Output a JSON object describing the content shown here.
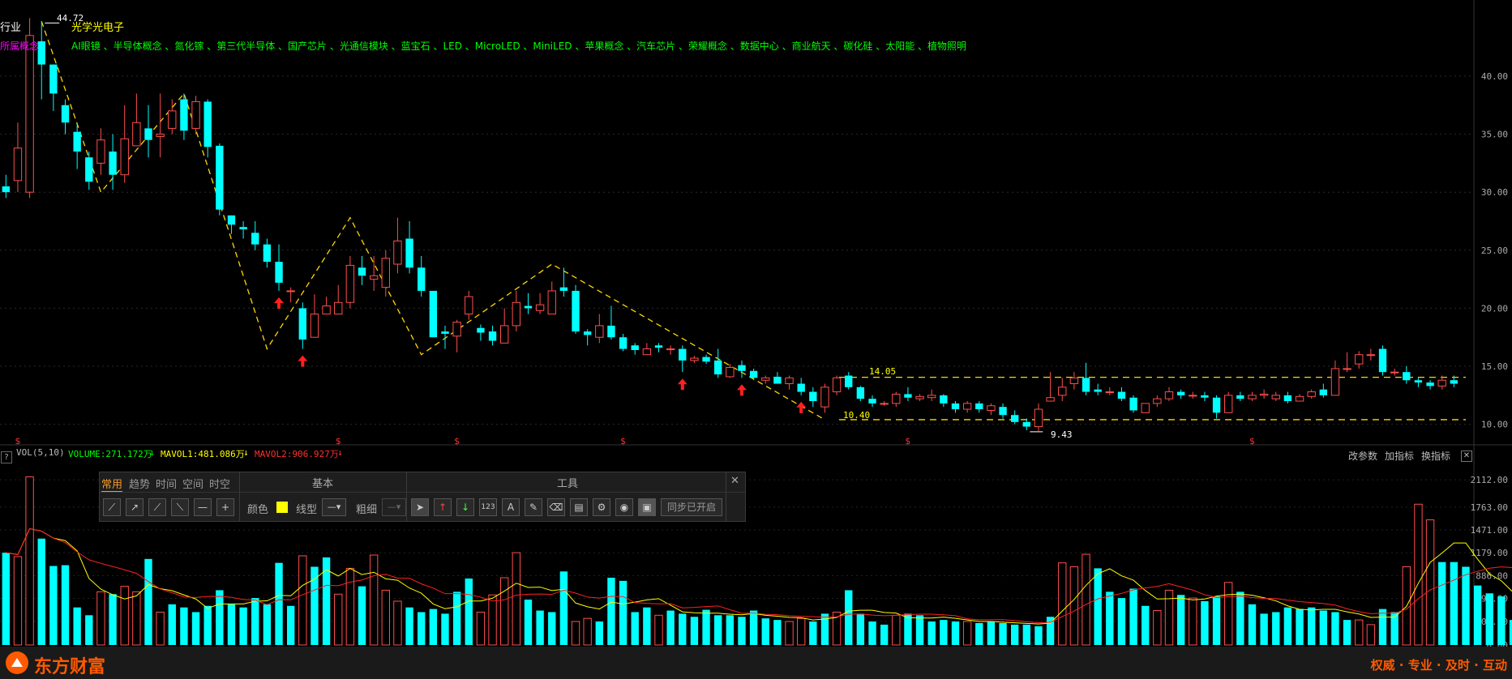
{
  "header": {
    "industry_label": "行业",
    "concept_label": "所属概念",
    "stock_name": "光学光电子",
    "concepts": "AI眼镜 、半导体概念 、氮化镓 、第三代半导体 、国产芯片 、光通信模块 、蓝宝石 、LED 、MicroLED 、MiniLED 、苹果概念 、汽车芯片 、荣耀概念 、数据中心 、商业航天 、碳化硅 、太阳能 、植物照明"
  },
  "price_annotations": {
    "high_label": "44.72",
    "level_upper": "14.05",
    "level_lower": "10.40",
    "low_label": "9.43"
  },
  "volume_panel": {
    "help": "?",
    "title": "VOL(5,10)",
    "volume": "VOLUME:271.172万",
    "mavol1": "MAVOL1:481.086万",
    "mavol2": "MAVOL2:906.927万",
    "change_params": "改参数",
    "add_indicator": "加指标",
    "switch_indicator": "换指标",
    "close": "✕"
  },
  "toolbar": {
    "tabs": [
      "常用",
      "趋势",
      "时间",
      "空间",
      "时空"
    ],
    "basic_title": "基本",
    "tools_title": "工具",
    "color_label": "颜色",
    "line_type_label": "线型",
    "thickness_label": "粗细",
    "sync_label": "同步已开启",
    "close": "✕",
    "tool_123": "123",
    "tool_a": "A"
  },
  "footer": {
    "brand": "东方财富",
    "slogan": "权威 · 专业 · 及时 · 互动"
  },
  "colors": {
    "up": "#ff4d4d",
    "down": "#00ffff",
    "ma1": "#ffff00",
    "ma2": "#ff2020",
    "zigzag": "#ffd700",
    "axis_text": "#aaaaaa",
    "brand": "#ff5a00",
    "concept_text": "#00ff00",
    "name_text": "#ffff00",
    "concept_label": "#ff00ff"
  },
  "chart_data": [
    {
      "type": "candlestick",
      "ylim": [
        9,
        46
      ],
      "yticks": [
        "40.00",
        "35.00",
        "30.00",
        "25.00",
        "20.00",
        "15.00",
        "10.00"
      ],
      "ytick_values": [
        40,
        35,
        30,
        25,
        20,
        15,
        10
      ],
      "candles": [
        [
          30.5,
          30,
          31.5,
          29.5
        ],
        [
          31,
          33.8,
          36,
          30
        ],
        [
          30,
          43.5,
          45,
          29.5
        ],
        [
          43,
          41,
          44.72,
          38
        ],
        [
          41,
          38.5,
          41,
          37
        ],
        [
          37.5,
          36,
          38,
          35
        ],
        [
          35.2,
          33.5,
          36,
          32
        ],
        [
          33,
          30.9,
          33.5,
          30.2
        ],
        [
          32.5,
          34.5,
          35.5,
          31.5
        ],
        [
          33.5,
          31.5,
          35,
          30.2
        ],
        [
          31.5,
          34.6,
          37.5,
          30.8
        ],
        [
          34,
          36,
          38.5,
          34
        ],
        [
          35.5,
          34.5,
          37.5,
          33
        ],
        [
          34.8,
          35,
          38.5,
          33
        ],
        [
          35.5,
          37,
          38,
          35
        ],
        [
          38,
          35.3,
          38.5,
          34.5
        ],
        [
          35.5,
          37.8,
          38.3,
          35
        ],
        [
          37.8,
          33.9,
          38,
          33
        ],
        [
          34,
          28.5,
          34.2,
          28
        ],
        [
          28,
          27.2,
          28,
          26.4
        ],
        [
          27,
          26.8,
          27.5,
          26
        ],
        [
          26.5,
          25.5,
          27.5,
          25
        ],
        [
          25.5,
          24,
          26,
          23.5
        ],
        [
          24,
          22.2,
          25.5,
          21.5
        ],
        [
          21.5,
          21.5,
          21.8,
          20.5
        ],
        [
          20,
          17.3,
          20.5,
          16.5
        ],
        [
          17.5,
          19.5,
          21.2,
          17.5
        ],
        [
          19.5,
          20.2,
          21,
          19.5
        ],
        [
          19.5,
          20.5,
          22,
          19.5
        ],
        [
          20.5,
          23.7,
          24.5,
          20
        ],
        [
          23.5,
          22.8,
          24.5,
          22
        ],
        [
          22.5,
          22.8,
          24.5,
          21.5
        ],
        [
          21.8,
          24.3,
          25,
          21
        ],
        [
          23.8,
          25.8,
          27.8,
          23
        ],
        [
          26,
          23.5,
          27.5,
          23
        ],
        [
          23.5,
          21.5,
          24.5,
          21
        ],
        [
          21.5,
          17.5,
          21.5,
          17.5
        ],
        [
          18,
          17.8,
          18.5,
          16.5
        ],
        [
          17.6,
          18.8,
          19,
          16.2
        ],
        [
          19.5,
          21,
          21.5,
          19
        ],
        [
          18.3,
          17.9,
          18.6,
          17.2
        ],
        [
          18,
          17.2,
          18.5,
          16.8
        ],
        [
          17,
          18.5,
          20,
          17
        ],
        [
          18.5,
          20.5,
          21.5,
          18
        ],
        [
          20.2,
          20,
          21.3,
          19.5
        ],
        [
          19.8,
          20.3,
          21.3,
          19.5
        ],
        [
          19.5,
          21.5,
          22.3,
          19.5
        ],
        [
          21.8,
          21.5,
          23.5,
          21
        ],
        [
          21.5,
          18,
          22,
          17.8
        ],
        [
          18,
          17.7,
          18.2,
          16.8
        ],
        [
          17.5,
          18.5,
          19.5,
          17
        ],
        [
          18.5,
          17.5,
          20.2,
          17.3
        ],
        [
          17.5,
          16.5,
          17.8,
          16.3
        ],
        [
          16.8,
          16.4,
          17,
          16
        ],
        [
          16,
          16.5,
          17,
          16
        ],
        [
          16.8,
          16.6,
          17,
          16.2
        ],
        [
          16.5,
          16.5,
          16.8,
          16
        ],
        [
          16.5,
          15.5,
          16.8,
          14.5
        ],
        [
          15.5,
          15.7,
          15.9,
          15.3
        ],
        [
          15.8,
          15.4,
          16,
          15.2
        ],
        [
          15.5,
          14.3,
          16.5,
          14
        ],
        [
          14.1,
          14.9,
          15.2,
          14
        ],
        [
          15.1,
          14.6,
          15.5,
          14
        ],
        [
          14.6,
          14,
          14.8,
          13.8
        ],
        [
          13.8,
          14,
          14.2,
          13.5
        ],
        [
          14.1,
          13.5,
          14.5,
          13.5
        ],
        [
          13.5,
          14,
          14.2,
          13
        ],
        [
          13.5,
          12.8,
          14,
          12.5
        ],
        [
          12.8,
          12,
          13.2,
          11.5
        ],
        [
          11.5,
          13.2,
          13.5,
          11
        ],
        [
          12.8,
          14,
          14.2,
          12.5
        ],
        [
          14.2,
          13.2,
          14.5,
          13
        ],
        [
          13.2,
          12.2,
          13.3,
          12
        ],
        [
          12.2,
          11.8,
          12.5,
          11.5
        ],
        [
          11.8,
          11.8,
          12,
          11.6
        ],
        [
          11.8,
          12.6,
          12.8,
          11.5
        ],
        [
          12.6,
          12.3,
          13.2,
          12
        ],
        [
          12.2,
          12.4,
          12.6,
          12
        ],
        [
          12.3,
          12.5,
          13,
          12
        ],
        [
          12.5,
          11.8,
          12.6,
          11.5
        ],
        [
          11.8,
          11.3,
          12,
          11
        ],
        [
          11.3,
          11.8,
          12,
          11
        ],
        [
          11.8,
          11.3,
          12,
          11
        ],
        [
          11.2,
          11.6,
          11.8,
          10.8
        ],
        [
          11.5,
          10.8,
          11.8,
          10.5
        ],
        [
          10.8,
          10.2,
          11.2,
          10
        ],
        [
          10.2,
          9.8,
          10.5,
          9.5
        ],
        [
          9.8,
          11.3,
          11.8,
          9.43
        ],
        [
          12,
          12.3,
          14.5,
          12
        ],
        [
          12.5,
          13.2,
          14,
          12
        ],
        [
          13.5,
          14,
          14.5,
          13
        ],
        [
          14,
          12.8,
          15.3,
          12.5
        ],
        [
          13,
          12.8,
          13.5,
          12.5
        ],
        [
          12.8,
          12.8,
          13.2,
          12.5
        ],
        [
          12.8,
          12.2,
          13.2,
          12
        ],
        [
          12.3,
          11.2,
          12.5,
          11
        ],
        [
          11,
          11.8,
          11.8,
          11
        ],
        [
          11.8,
          12.2,
          12.5,
          11.5
        ],
        [
          12.2,
          12.8,
          13.2,
          12
        ],
        [
          12.8,
          12.5,
          13,
          12.2
        ],
        [
          12.5,
          12.5,
          12.8,
          12.2
        ],
        [
          12.5,
          12.3,
          12.8,
          12
        ],
        [
          12.3,
          11,
          12.5,
          10.5
        ],
        [
          11,
          12.5,
          12.8,
          11
        ],
        [
          12.5,
          12.2,
          12.8,
          12
        ],
        [
          12.2,
          12.5,
          12.8,
          12
        ],
        [
          12.5,
          12.6,
          13,
          12.2
        ],
        [
          12.2,
          12.5,
          12.8,
          12
        ],
        [
          12.5,
          12,
          12.8,
          11.8
        ],
        [
          12,
          12.4,
          12.6,
          12
        ],
        [
          12.4,
          12.8,
          13,
          12.2
        ],
        [
          13,
          12.5,
          13.5,
          12.3
        ],
        [
          12.5,
          14.8,
          15.5,
          12.5
        ],
        [
          14.8,
          14.8,
          16.2,
          14.5
        ],
        [
          15.2,
          16,
          16.3,
          14.8
        ],
        [
          16,
          16,
          16.5,
          15.5
        ],
        [
          16.5,
          14.5,
          16.8,
          14.2
        ],
        [
          14.5,
          14.5,
          14.8,
          14.2
        ],
        [
          14.5,
          13.8,
          15,
          13.5
        ],
        [
          13.8,
          13.6,
          14,
          13.2
        ],
        [
          13.6,
          13.3,
          13.8,
          13
        ],
        [
          13.3,
          13.8,
          14.2,
          13
        ],
        [
          13.8,
          13.5,
          14.2,
          13.2
        ]
      ],
      "zigzag": [
        [
          3,
          44.72
        ],
        [
          8,
          30
        ],
        [
          15,
          38.5
        ],
        [
          22,
          16.5
        ],
        [
          29,
          27.8
        ],
        [
          35,
          16
        ],
        [
          46,
          23.8
        ],
        [
          69,
          10.4
        ]
      ],
      "hlines": [
        {
          "label": "14.05",
          "value": 14.05
        },
        {
          "label": "10.40",
          "value": 10.4
        }
      ],
      "signals": [
        23,
        25,
        57,
        62,
        67
      ],
      "s_markers": [
        1,
        28,
        38,
        52,
        76,
        105
      ]
    },
    {
      "type": "bar",
      "ylim": [
        0,
        2300
      ],
      "yticks": [
        "2112.00",
        "1763.00",
        "1471.00",
        "1179.00",
        "886.00",
        "594.00",
        "302.00",
        "0.00"
      ],
      "ytick_values": [
        2112,
        1763,
        1471,
        1179,
        886,
        594,
        302,
        0
      ],
      "values": [
        1180,
        1130,
        2150,
        1360,
        1010,
        1020,
        480,
        380,
        680,
        650,
        750,
        680,
        1100,
        420,
        520,
        480,
        420,
        500,
        700,
        520,
        480,
        600,
        520,
        1050,
        500,
        1140,
        1000,
        1120,
        650,
        980,
        750,
        1150,
        700,
        560,
        480,
        420,
        460,
        400,
        680,
        850,
        420,
        640,
        860,
        1180,
        580,
        440,
        420,
        940,
        300,
        340,
        300,
        860,
        820,
        420,
        480,
        380,
        440,
        400,
        360,
        450,
        380,
        380,
        360,
        440,
        340,
        320,
        300,
        340,
        300,
        400,
        420,
        700,
        400,
        300,
        260,
        380,
        400,
        380,
        300,
        320,
        300,
        300,
        280,
        300,
        280,
        260,
        260,
        240,
        360,
        1050,
        1000,
        1160,
        980,
        680,
        600,
        720,
        500,
        440,
        700,
        640,
        600,
        560,
        620,
        800,
        680,
        520,
        400,
        420,
        480,
        460,
        480,
        440,
        420,
        320,
        320,
        260,
        460,
        420,
        1000,
        1800,
        1600,
        1060,
        1060,
        1000,
        760,
        660,
        620,
        320
      ],
      "up_flags": [
        0,
        1,
        1,
        0,
        0,
        0,
        0,
        0,
        1,
        0,
        1,
        1,
        0,
        1,
        0,
        0,
        0,
        0,
        0,
        0,
        0,
        0,
        0,
        0,
        0,
        1,
        0,
        0,
        1,
        1,
        0,
        1,
        1,
        1,
        0,
        0,
        0,
        0,
        0,
        0,
        1,
        1,
        1,
        1,
        0,
        0,
        0,
        0,
        1,
        1,
        0,
        0,
        0,
        0,
        0,
        1,
        0,
        0,
        0,
        0,
        0,
        0,
        0,
        0,
        0,
        0,
        1,
        1,
        0,
        0,
        1,
        0,
        0,
        0,
        0,
        1,
        0,
        0,
        0,
        0,
        0,
        1,
        0,
        0,
        0,
        0,
        0,
        0,
        0,
        1,
        1,
        1,
        0,
        0,
        0,
        0,
        0,
        1,
        1,
        0,
        1,
        0,
        0,
        1,
        0,
        0,
        0,
        0,
        0,
        0,
        0,
        0,
        0,
        0,
        1,
        1,
        0,
        0,
        1,
        1,
        1,
        0,
        0,
        0,
        0,
        0,
        0,
        0
      ]
    }
  ]
}
